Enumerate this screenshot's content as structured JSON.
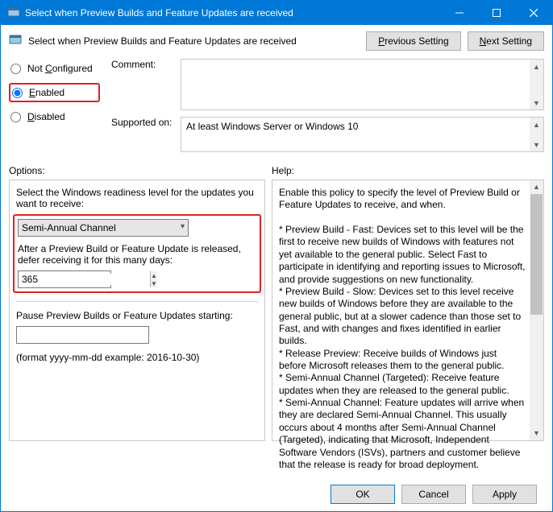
{
  "titlebar": {
    "title": "Select when Preview Builds and Feature Updates are received"
  },
  "header": {
    "heading": "Select when Preview Builds and Feature Updates are received",
    "previous": "Previous Setting",
    "next": "Next Setting"
  },
  "radios": {
    "not_configured": "Not Configured",
    "enabled": "Enabled",
    "disabled": "Disabled",
    "selected": "enabled"
  },
  "comment": {
    "label": "Comment:",
    "value": ""
  },
  "supported": {
    "label": "Supported on:",
    "value": "At least Windows Server or Windows 10"
  },
  "sections": {
    "options": "Options:",
    "help": "Help:"
  },
  "options": {
    "readiness_label": "Select the Windows readiness level for the updates you want to receive:",
    "readiness_value": "Semi-Annual Channel",
    "defer_label": "After a Preview Build or Feature Update is released, defer receiving it for this many days:",
    "defer_value": "365",
    "pause_label": "Pause Preview Builds or Feature Updates starting:",
    "pause_value": "",
    "format_hint": "(format yyyy-mm-dd example: 2016-10-30)"
  },
  "help": {
    "text": "Enable this policy to specify the level of Preview Build or Feature Updates to receive, and when.\n\n* Preview Build - Fast: Devices set to this level will be the first to receive new builds of Windows with features not yet available to the general public. Select Fast to participate in identifying and reporting issues to Microsoft, and provide suggestions on new functionality.\n* Preview Build - Slow: Devices set to this level receive new builds of Windows before they are available to the general public, but at a slower cadence than those set to Fast, and with changes and fixes identified in earlier builds.\n* Release Preview: Receive builds of Windows just before Microsoft releases them to the general public.\n* Semi-Annual Channel (Targeted): Receive feature updates when they are released to the general public.\n* Semi-Annual Channel: Feature updates will arrive when they are declared Semi-Annual Channel. This usually occurs about 4 months after Semi-Annual Channel (Targeted), indicating that Microsoft, Independent Software Vendors (ISVs), partners and customer believe that the release is ready for broad deployment."
  },
  "footer": {
    "ok": "OK",
    "cancel": "Cancel",
    "apply": "Apply"
  }
}
